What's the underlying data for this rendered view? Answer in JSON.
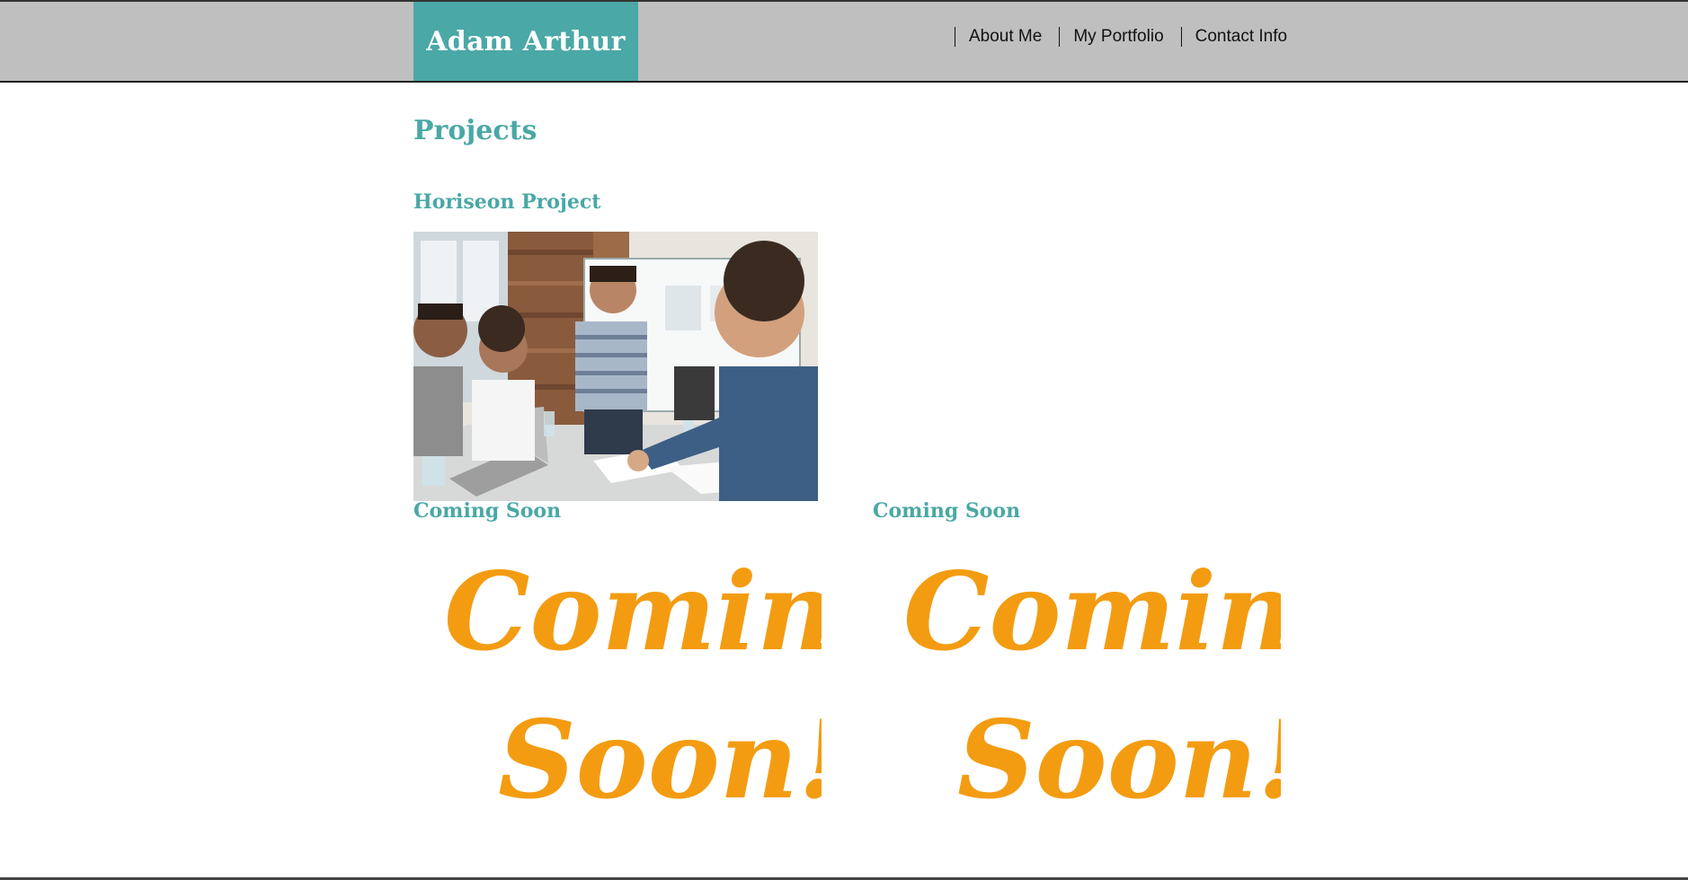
{
  "header": {
    "brand": "Adam Arthur",
    "nav": [
      {
        "label": "About Me"
      },
      {
        "label": "My Portfolio"
      },
      {
        "label": "Contact Info"
      }
    ]
  },
  "main": {
    "section_title": "Projects",
    "projects": [
      {
        "title": "Horiseon Project",
        "image": "team-meeting-photo"
      },
      {
        "title": "Coming Soon",
        "image": "coming-soon-graphic",
        "graphic_text": [
          "Coming",
          "Soon!"
        ]
      },
      {
        "title": "Coming Soon",
        "image": "coming-soon-graphic",
        "graphic_text": [
          "Coming",
          "Soon!"
        ]
      }
    ]
  },
  "colors": {
    "header_bg": "#bfbfbf",
    "accent": "#4aa8a6",
    "coming_soon": "#f39c12"
  }
}
